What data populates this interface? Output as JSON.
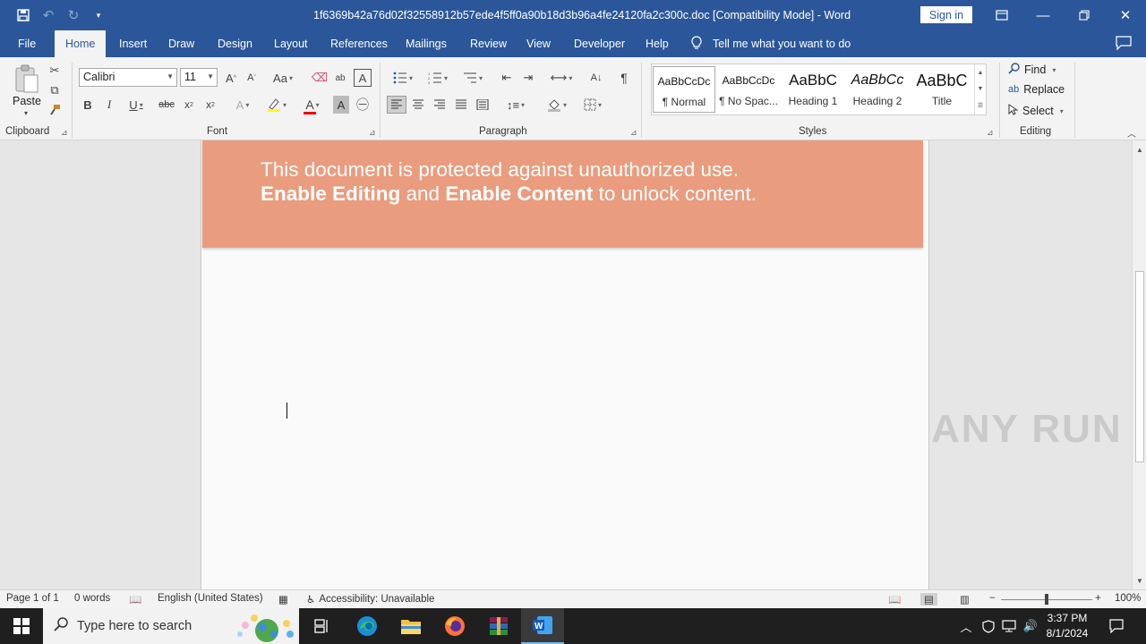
{
  "window": {
    "title": "1f6369b42a76d02f32558912b57ede4f5ff0a90b18d3b96a4fe24120fa2c300c.doc [Compatibility Mode]  -  Word",
    "sign_in": "Sign in"
  },
  "tabs": [
    "File",
    "Home",
    "Insert",
    "Draw",
    "Design",
    "Layout",
    "References",
    "Mailings",
    "Review",
    "View",
    "Developer",
    "Help"
  ],
  "tell_me": "Tell me what you want to do",
  "ribbon": {
    "clipboard": {
      "paste": "Paste",
      "label": "Clipboard"
    },
    "font": {
      "name": "Calibri",
      "size": "11",
      "label": "Font",
      "change_case": "Aa"
    },
    "paragraph": {
      "label": "Paragraph"
    },
    "styles": {
      "label": "Styles",
      "items": [
        {
          "preview": "AaBbCcDc",
          "name": "¶ Normal"
        },
        {
          "preview": "AaBbCcDc",
          "name": "¶ No Spac..."
        },
        {
          "preview": "AaBbC",
          "name": "Heading 1"
        },
        {
          "preview": "AaBbCc",
          "name": "Heading 2"
        },
        {
          "preview": "AaBbC",
          "name": "Title"
        }
      ]
    },
    "editing": {
      "label": "Editing",
      "find": "Find",
      "replace": "Replace",
      "select": "Select"
    }
  },
  "document": {
    "banner_line1": "This document is protected against unauthorized use.",
    "banner_bold1": "Enable Editing",
    "banner_mid": " and ",
    "banner_bold2": "Enable Content",
    "banner_end": " to unlock content.",
    "banner_color": "#ea9c7e"
  },
  "watermark": "ANY RUN",
  "status": {
    "page": "Page 1 of 1",
    "words": "0 words",
    "language": "English (United States)",
    "accessibility": "Accessibility: Unavailable",
    "zoom": "100%"
  },
  "taskbar": {
    "search_placeholder": "Type here to search",
    "time": "3:37 PM",
    "date": "8/1/2024"
  },
  "colors": {
    "word_blue": "#2b579a",
    "ribbon_bg": "#f3f3f3",
    "taskbar_bg": "#1f1f1f"
  }
}
